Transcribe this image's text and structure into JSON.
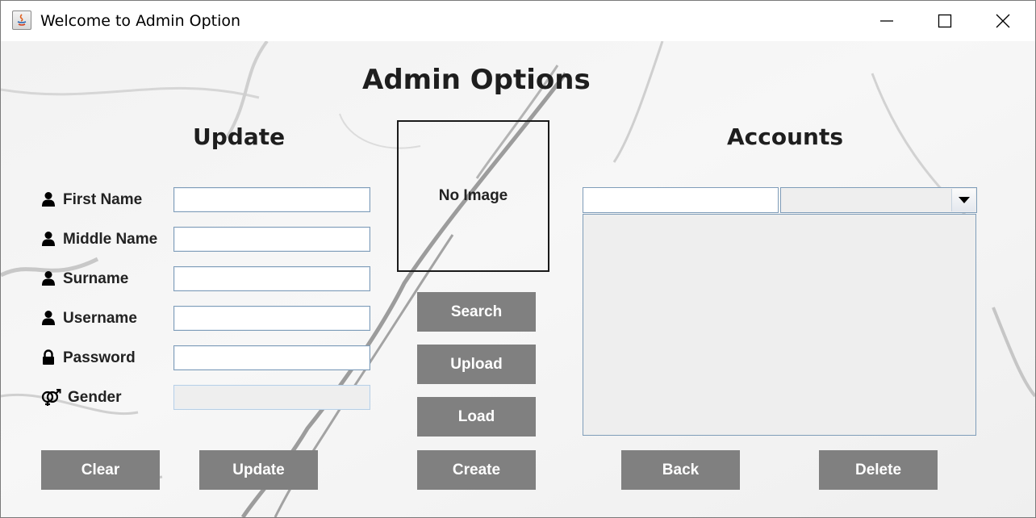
{
  "window": {
    "title": "Welcome to Admin Option"
  },
  "page": {
    "main_title": "Admin Options"
  },
  "update_section": {
    "heading": "Update",
    "fields": [
      {
        "label": "First Name",
        "icon": "user-icon",
        "value": ""
      },
      {
        "label": "Middle Name",
        "icon": "user-icon",
        "value": ""
      },
      {
        "label": "Surname",
        "icon": "user-icon",
        "value": ""
      },
      {
        "label": "Username",
        "icon": "user-icon",
        "value": ""
      },
      {
        "label": "Password",
        "icon": "lock-icon",
        "value": ""
      },
      {
        "label": "Gender",
        "icon": "gender-icon",
        "value": ""
      }
    ],
    "clear_label": "Clear",
    "update_label": "Update"
  },
  "image_panel": {
    "placeholder": "No Image",
    "search_label": "Search",
    "upload_label": "Upload",
    "load_label": "Load",
    "create_label": "Create"
  },
  "accounts_section": {
    "heading": "Accounts",
    "search_value": "",
    "filter_selected": "",
    "back_label": "Back",
    "delete_label": "Delete"
  },
  "colors": {
    "button_bg": "#808080",
    "button_text": "#ffffff",
    "field_border": "#7f9db9",
    "heading_text": "#1e1e1e"
  }
}
